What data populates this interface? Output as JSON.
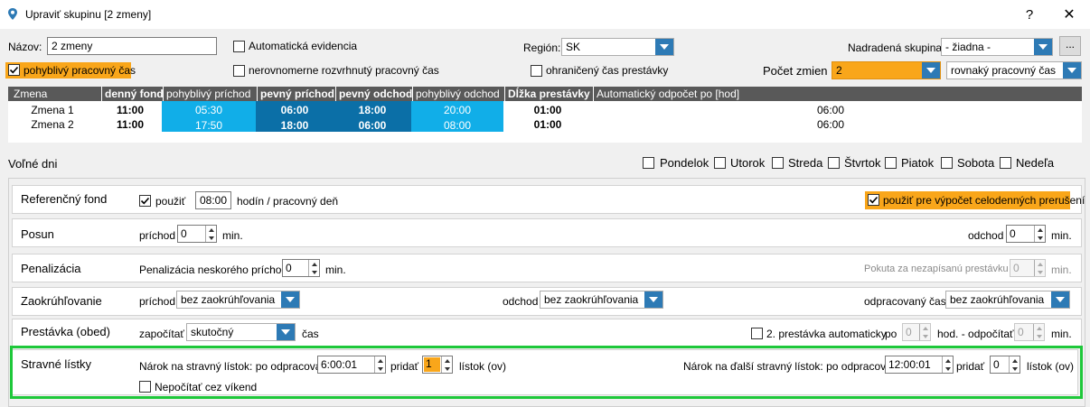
{
  "window": {
    "title": "Upraviť skupinu [2 zmeny]",
    "help": "?",
    "close": "✕"
  },
  "top": {
    "name_label": "Názov:",
    "name_value": "2 zmeny",
    "auto_evidence_label": "Automatická evidencia",
    "region_label": "Región:",
    "region_value": "SK",
    "parent_label": "Nadradená skupina:",
    "parent_value": "- žiadna -",
    "more_button": "...",
    "flexible_label": "pohyblivý pracovný čas",
    "uneven_label": "nerovnomerne rozvrhnutý pracovný čas",
    "limited_break_label": "ohraničený čas prestávky",
    "shift_count_label": "Počet zmien",
    "shift_count_value": "2",
    "worktime_mode_value": "rovnaký pracovný čas"
  },
  "table": {
    "headers": [
      "Zmena",
      "denný fond",
      "pohyblivý príchod",
      "pevný príchod",
      "pevný odchod",
      "pohyblivý odchod",
      "Dĺžka prestávky",
      "Automatický odpočet po [hod]"
    ],
    "rows": [
      {
        "name": "Zmena 1",
        "fund": "11:00",
        "flex_in": "05:30",
        "fixed_in": "06:00",
        "fixed_out": "18:00",
        "flex_out": "20:00",
        "break": "01:00",
        "auto": "06:00"
      },
      {
        "name": "Zmena 2",
        "fund": "11:00",
        "flex_in": "17:50",
        "fixed_in": "18:00",
        "fixed_out": "06:00",
        "flex_out": "08:00",
        "break": "01:00",
        "auto": "06:00"
      }
    ]
  },
  "days": {
    "label": "Voľné dni",
    "items": [
      "Pondelok",
      "Utorok",
      "Streda",
      "Štvrtok",
      "Piatok",
      "Sobota",
      "Nedeľa"
    ]
  },
  "ref_fund": {
    "title": "Referenčný fond",
    "use_label": "použiť",
    "hours_value": "08:00",
    "unit_label": "hodín / pracovný deň",
    "full_day_label": "použiť pre výpočet celodenných prerušení"
  },
  "shift": {
    "title": "Posun",
    "arrival_label": "príchod",
    "arrival_value": "0",
    "min1": "min.",
    "departure_label": "odchod",
    "departure_value": "0",
    "min2": "min."
  },
  "penalty": {
    "title": "Penalizácia",
    "late_label": "Penalizácia neskorého príchodu:",
    "late_value": "0",
    "min1": "min.",
    "unwritten_label": "Pokuta za nezapísanú prestávku",
    "unwritten_value": "0",
    "min2": "min."
  },
  "rounding": {
    "title": "Zaokrúhľovanie",
    "arrival_label": "príchod",
    "arrival_value": "bez zaokrúhľovania",
    "departure_label": "odchod",
    "departure_value": "bez zaokrúhľovania",
    "worked_label": "odpracovaný čas",
    "worked_value": "bez zaokrúhľovania"
  },
  "lunch": {
    "title": "Prestávka (obed)",
    "count_label": "započítať",
    "count_value": "skutočný",
    "time_label": "čas",
    "second_break_label": "2. prestávka automaticky",
    "after_label": "po",
    "after_value": "0",
    "hours_label": "hod. - odpočítať",
    "deduct_value": "0",
    "min_label": "min."
  },
  "meal": {
    "title": "Stravné lístky",
    "claim_label": "Nárok na stravný lístok: po odpracovaní",
    "claim_value": "6:00:01",
    "add_label": "pridať",
    "add_value": "1",
    "tickets_label": "lístok (ov)",
    "next_claim_label": "Nárok na ďalší stravný lístok: po odpracovaní",
    "next_claim_value": "12:00:01",
    "next_add_label": "pridať",
    "next_add_value": "0",
    "next_tickets_label": "lístok (ov)",
    "weekend_label": "Nepočítať cez víkend"
  }
}
